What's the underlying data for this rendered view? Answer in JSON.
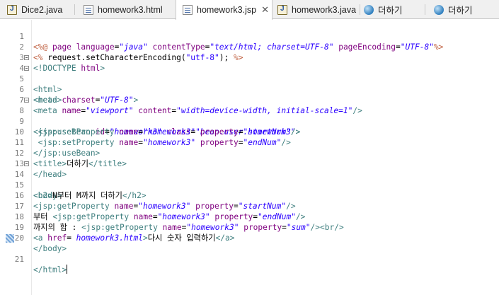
{
  "tabs": [
    {
      "label": "Dice2.java",
      "icon": "java-file-icon"
    },
    {
      "label": "homework3.html",
      "icon": "html-file-icon"
    },
    {
      "label": "homework3.jsp",
      "icon": "jsp-file-icon",
      "active": true,
      "close": "✕"
    },
    {
      "label": "homework3.java",
      "icon": "java-file-icon"
    },
    {
      "label": "더하기",
      "icon": "globe-icon"
    },
    {
      "label": "더하기",
      "icon": "globe-icon"
    }
  ],
  "editor": {
    "current_line": 21,
    "line_numbers": [
      "1",
      "2",
      "3",
      "4",
      "5",
      "6",
      "7",
      "8",
      "9",
      "10",
      "11",
      "12",
      "13",
      "14",
      "15",
      "16",
      "17",
      "18",
      "19",
      "20",
      "21"
    ]
  },
  "colors": {
    "tag": "#3f7f7f",
    "attribute_name": "#7f007f",
    "attribute_value": "#2a00ff",
    "directive": "#bf5f3f",
    "keyword": "#7f0055"
  }
}
